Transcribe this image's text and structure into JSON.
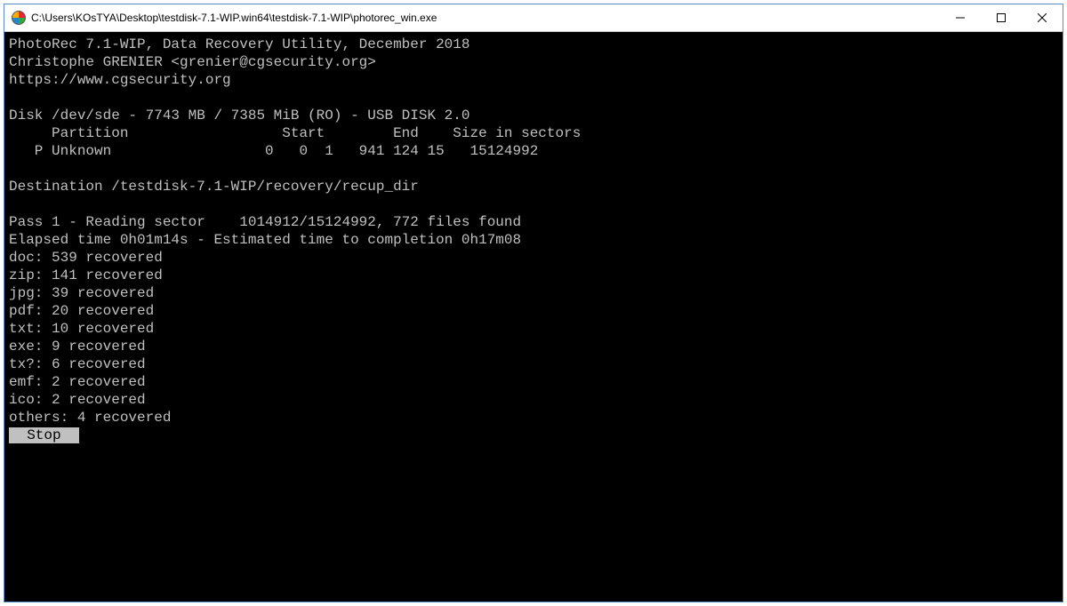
{
  "window": {
    "title": "C:\\Users\\KOsTYA\\Desktop\\testdisk-7.1-WIP.win64\\testdisk-7.1-WIP\\photorec_win.exe"
  },
  "header": {
    "banner": "PhotoRec 7.1-WIP, Data Recovery Utility, December 2018",
    "author": "Christophe GRENIER <grenier@cgsecurity.org>",
    "url": "https://www.cgsecurity.org"
  },
  "disk": {
    "line": "Disk /dev/sde - 7743 MB / 7385 MiB (RO) - USB DISK 2.0",
    "columns": "     Partition                  Start        End    Size in sectors",
    "row": "   P Unknown                  0   0  1   941 124 15   15124992"
  },
  "destination": "Destination /testdisk-7.1-WIP/recovery/recup_dir",
  "progress": {
    "pass": "Pass 1 - Reading sector    1014912/15124992, 772 files found",
    "elapsed": "Elapsed time 0h01m14s - Estimated time to completion 0h17m08"
  },
  "recovered": [
    "doc: 539 recovered",
    "zip: 141 recovered",
    "jpg: 39 recovered",
    "pdf: 20 recovered",
    "txt: 10 recovered",
    "exe: 9 recovered",
    "tx?: 6 recovered",
    "emf: 2 recovered",
    "ico: 2 recovered",
    "others: 4 recovered"
  ],
  "button": {
    "stop": "  Stop  "
  }
}
